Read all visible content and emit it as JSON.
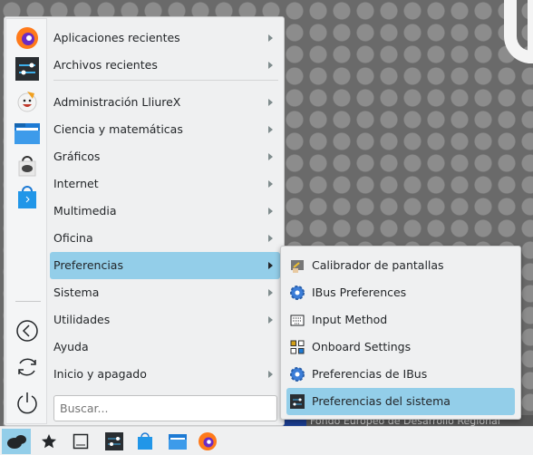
{
  "menu": {
    "items": [
      {
        "label": "Aplicaciones recientes",
        "submenu": true
      },
      {
        "label": "Archivos recientes",
        "submenu": true
      },
      {
        "label": "Administración LliureX",
        "submenu": true
      },
      {
        "label": "Ciencia y matemáticas",
        "submenu": true
      },
      {
        "label": "Gráficos",
        "submenu": true
      },
      {
        "label": "Internet",
        "submenu": true
      },
      {
        "label": "Multimedia",
        "submenu": true
      },
      {
        "label": "Oficina",
        "submenu": true
      },
      {
        "label": "Preferencias",
        "submenu": true,
        "selected": true
      },
      {
        "label": "Sistema",
        "submenu": true
      },
      {
        "label": "Utilidades",
        "submenu": true
      },
      {
        "label": "Ayuda",
        "submenu": false
      },
      {
        "label": "Inicio y apagado",
        "submenu": true
      }
    ],
    "search_placeholder": "Buscar...",
    "favorites": [
      "firefox-icon",
      "system-settings-icon",
      "help-face-icon",
      "folder-icon",
      "bag-lock-icon",
      "software-store-icon"
    ],
    "session_buttons": [
      "logout-icon",
      "restart-icon",
      "shutdown-icon"
    ]
  },
  "submenu": {
    "items": [
      {
        "label": "Calibrador de pantallas",
        "icon": "calibrate-icon"
      },
      {
        "label": "IBus Preferences",
        "icon": "gear-icon"
      },
      {
        "label": "Input Method",
        "icon": "keyboard-icon"
      },
      {
        "label": "Onboard Settings",
        "icon": "onboard-icon"
      },
      {
        "label": "Preferencias de IBus",
        "icon": "gear-icon"
      },
      {
        "label": "Preferencias del sistema",
        "icon": "system-settings-icon",
        "selected": true
      }
    ]
  },
  "desktop": {
    "banner_text": "Fondo Europeo de Desarrollo Regional"
  },
  "taskbar": {
    "items": [
      "launcher-icon",
      "favorites-star-icon",
      "show-desktop-icon",
      "system-settings-icon",
      "software-store-icon",
      "folder-icon",
      "firefox-icon"
    ]
  },
  "colors": {
    "accent": "#93cee9",
    "menu_bg": "#eff0f1"
  }
}
